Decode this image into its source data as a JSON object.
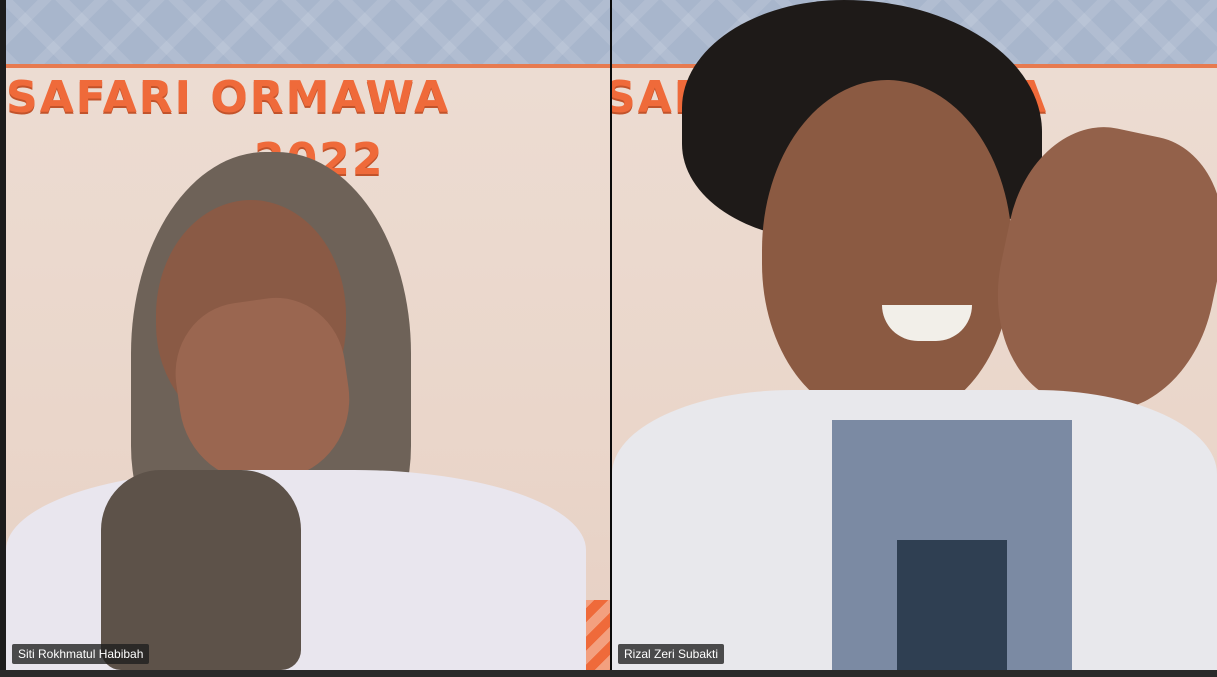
{
  "meeting": {
    "participants": [
      {
        "name": "Siti Rokhmatul Habibah",
        "background_title": "SAFARI ORMAWA",
        "background_year": "2022"
      },
      {
        "name": "Rizal Zeri Subakti",
        "background_title": "SAFARI ORMAWA"
      }
    ]
  },
  "colors": {
    "banner_orange": "#ef6a3a",
    "banner_sky": "#a8b6cc",
    "background_cream": "#ead8cc",
    "name_tag_bg": "#1e1e1e"
  }
}
